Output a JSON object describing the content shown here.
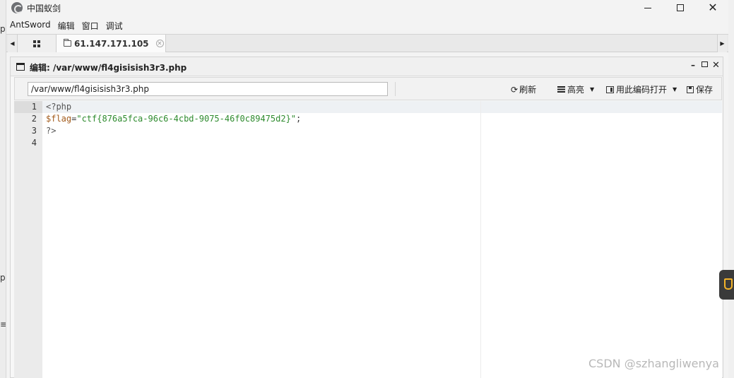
{
  "background_window": {
    "text_fragment_1": "p",
    "text_fragment_2": "p",
    "text_fragment_3": "≡"
  },
  "window": {
    "title": "中国蚁剑",
    "controls": {
      "minimize": "",
      "maximize": "",
      "close": "✕"
    }
  },
  "menu": [
    {
      "label": "AntSword"
    },
    {
      "label": "编辑"
    },
    {
      "label": "窗口"
    },
    {
      "label": "调试"
    }
  ],
  "tabs": {
    "left_arrow": "◀",
    "right_arrow": "▶",
    "server_tab": {
      "label": "61.147.171.105",
      "close": "✕"
    }
  },
  "editor_panel": {
    "title": "编辑: /var/www/fl4gisisish3r3.php",
    "controls": {
      "minimize": "–",
      "close": "✕"
    },
    "toolbar": {
      "path_value": "/var/www/fl4gisisish3r3.php",
      "refresh_icon": "⟳",
      "refresh_label": "刷新",
      "highlight_label": "高亮",
      "highlight_caret": "▼",
      "encoding_label": "用此编码打开",
      "encoding_caret": "▼",
      "save_label": "保存"
    },
    "code": {
      "line_numbers": [
        "1",
        "2",
        "3",
        "4"
      ],
      "line1": "<?php",
      "line2_var": "$flag",
      "line2_eq": "=",
      "line2_str": "\"ctf{876a5fca-96c6-4cbd-9075-46f0c89475d2}\"",
      "line2_end": ";",
      "line3": "?>",
      "line4": ""
    }
  },
  "watermark": "CSDN @szhangliwenya",
  "colors": {
    "code_variable": "#a25a1a",
    "code_string": "#2e8b2e",
    "side_widget_accent": "#f3b329"
  }
}
